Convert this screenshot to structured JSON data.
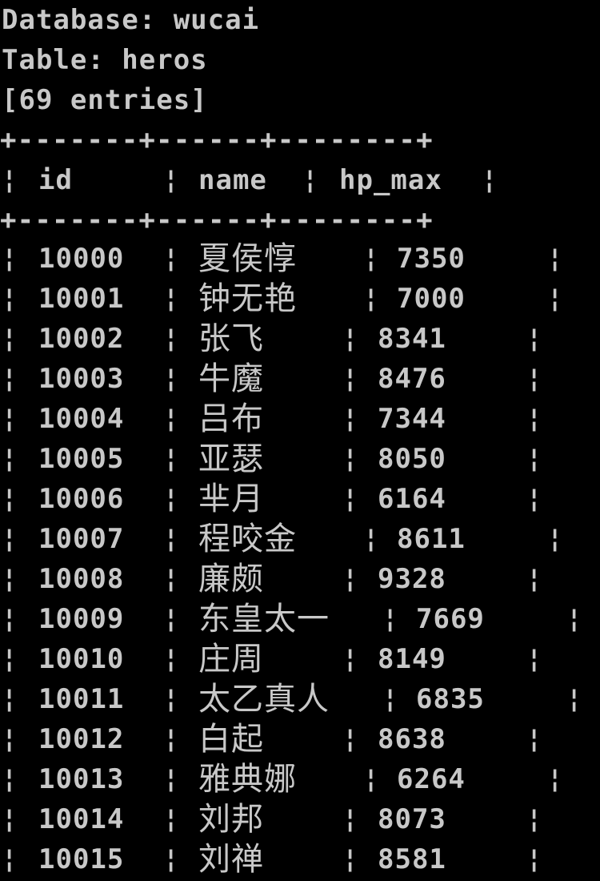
{
  "header": {
    "database_line": "Database: wucai",
    "table_line": "Table: heros",
    "entries_line": "[69 entries]"
  },
  "table": {
    "separator": "+-------+------+--------+",
    "columns": [
      "id",
      "name",
      "hp_max"
    ],
    "rows": [
      {
        "id": "10000",
        "name": "夏侯惇",
        "hp_max": "7350"
      },
      {
        "id": "10001",
        "name": "钟无艳",
        "hp_max": "7000"
      },
      {
        "id": "10002",
        "name": "张飞",
        "hp_max": "8341"
      },
      {
        "id": "10003",
        "name": "牛魔",
        "hp_max": "8476"
      },
      {
        "id": "10004",
        "name": "吕布",
        "hp_max": "7344"
      },
      {
        "id": "10005",
        "name": "亚瑟",
        "hp_max": "8050"
      },
      {
        "id": "10006",
        "name": "芈月",
        "hp_max": "6164"
      },
      {
        "id": "10007",
        "name": "程咬金",
        "hp_max": "8611"
      },
      {
        "id": "10008",
        "name": "廉颇",
        "hp_max": "9328"
      },
      {
        "id": "10009",
        "name": "东皇太一",
        "hp_max": "7669"
      },
      {
        "id": "10010",
        "name": "庄周",
        "hp_max": "8149"
      },
      {
        "id": "10011",
        "name": "太乙真人",
        "hp_max": "6835"
      },
      {
        "id": "10012",
        "name": "白起",
        "hp_max": "8638"
      },
      {
        "id": "10013",
        "name": "雅典娜",
        "hp_max": "6264"
      },
      {
        "id": "10014",
        "name": "刘邦",
        "hp_max": "8073"
      },
      {
        "id": "10015",
        "name": "刘禅",
        "hp_max": "8581"
      }
    ]
  },
  "colors": {
    "background": "#000000",
    "text": "#c8c8c8"
  }
}
